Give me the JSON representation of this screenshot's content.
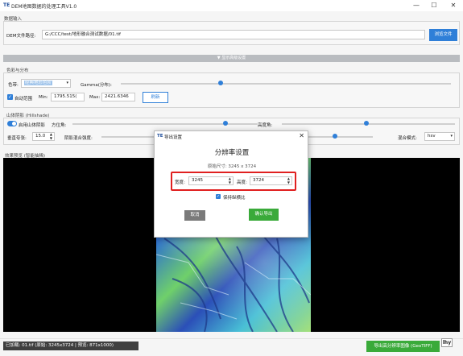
{
  "window": {
    "logo": "TE",
    "title": "DEM地图数据的处理工具V1.0",
    "min_icon": "—",
    "max_icon": "☐",
    "close_icon": "✕"
  },
  "dem_input": {
    "section_title": "数据输入",
    "path_label": "DEM文件路径:",
    "path_value": "G:/CCC/test/地形融合测试数据/01.tif",
    "browse_label": "浏览文件"
  },
  "collapse_bar": {
    "label": "▼ 显示高级设置"
  },
  "color": {
    "section_title": "色彩与分布",
    "colormap_label": "色带:",
    "colormap_value": "经典地形色阶",
    "gamma_label": "Gamma(分布):",
    "gamma_level": 0.5,
    "auto_range_label": "自动范围",
    "min_label": "Min:",
    "min_value": "1795.515(",
    "max_label": "Max:",
    "max_value": "2421.6346",
    "refresh_label": "刷新"
  },
  "hillshade": {
    "section_title": "山体阴影 (Hillshade)",
    "enable_label": "启用山体阴影",
    "azimuth_label": "方位角:",
    "altitude_label": "高度角:",
    "zfactor_label": "垂直夸张:",
    "zfactor_value": "15.0",
    "blend_strength_label": "阴影混合强度:",
    "blend_mode_label": "混合模式:",
    "blend_mode_value": "hsv"
  },
  "preview": {
    "section_title": "效果预览 (智能抽稀)"
  },
  "status": {
    "text": "已加载: 01.tif (原始: 3245x3724 | 预览: 871x1000)",
    "export_label": "导出高分辨率图像 (GeoTIFF)",
    "badge": "lhy"
  },
  "dialog": {
    "logo": "TE",
    "title": "导出设置",
    "close_icon": "✕",
    "heading": "分辨率设置",
    "original_size": "原始尺寸: 3245 x 3724",
    "width_label": "宽度:",
    "width_value": "3245",
    "height_label": "高度:",
    "height_value": "3724",
    "keep_ratio_label": "保持纵横比",
    "cancel_label": "取消",
    "confirm_label": "确认导出"
  },
  "colors": {
    "accent_blue": "#2f7fd8",
    "confirm_green": "#3aaa3a",
    "highlight_red": "#e02020"
  }
}
